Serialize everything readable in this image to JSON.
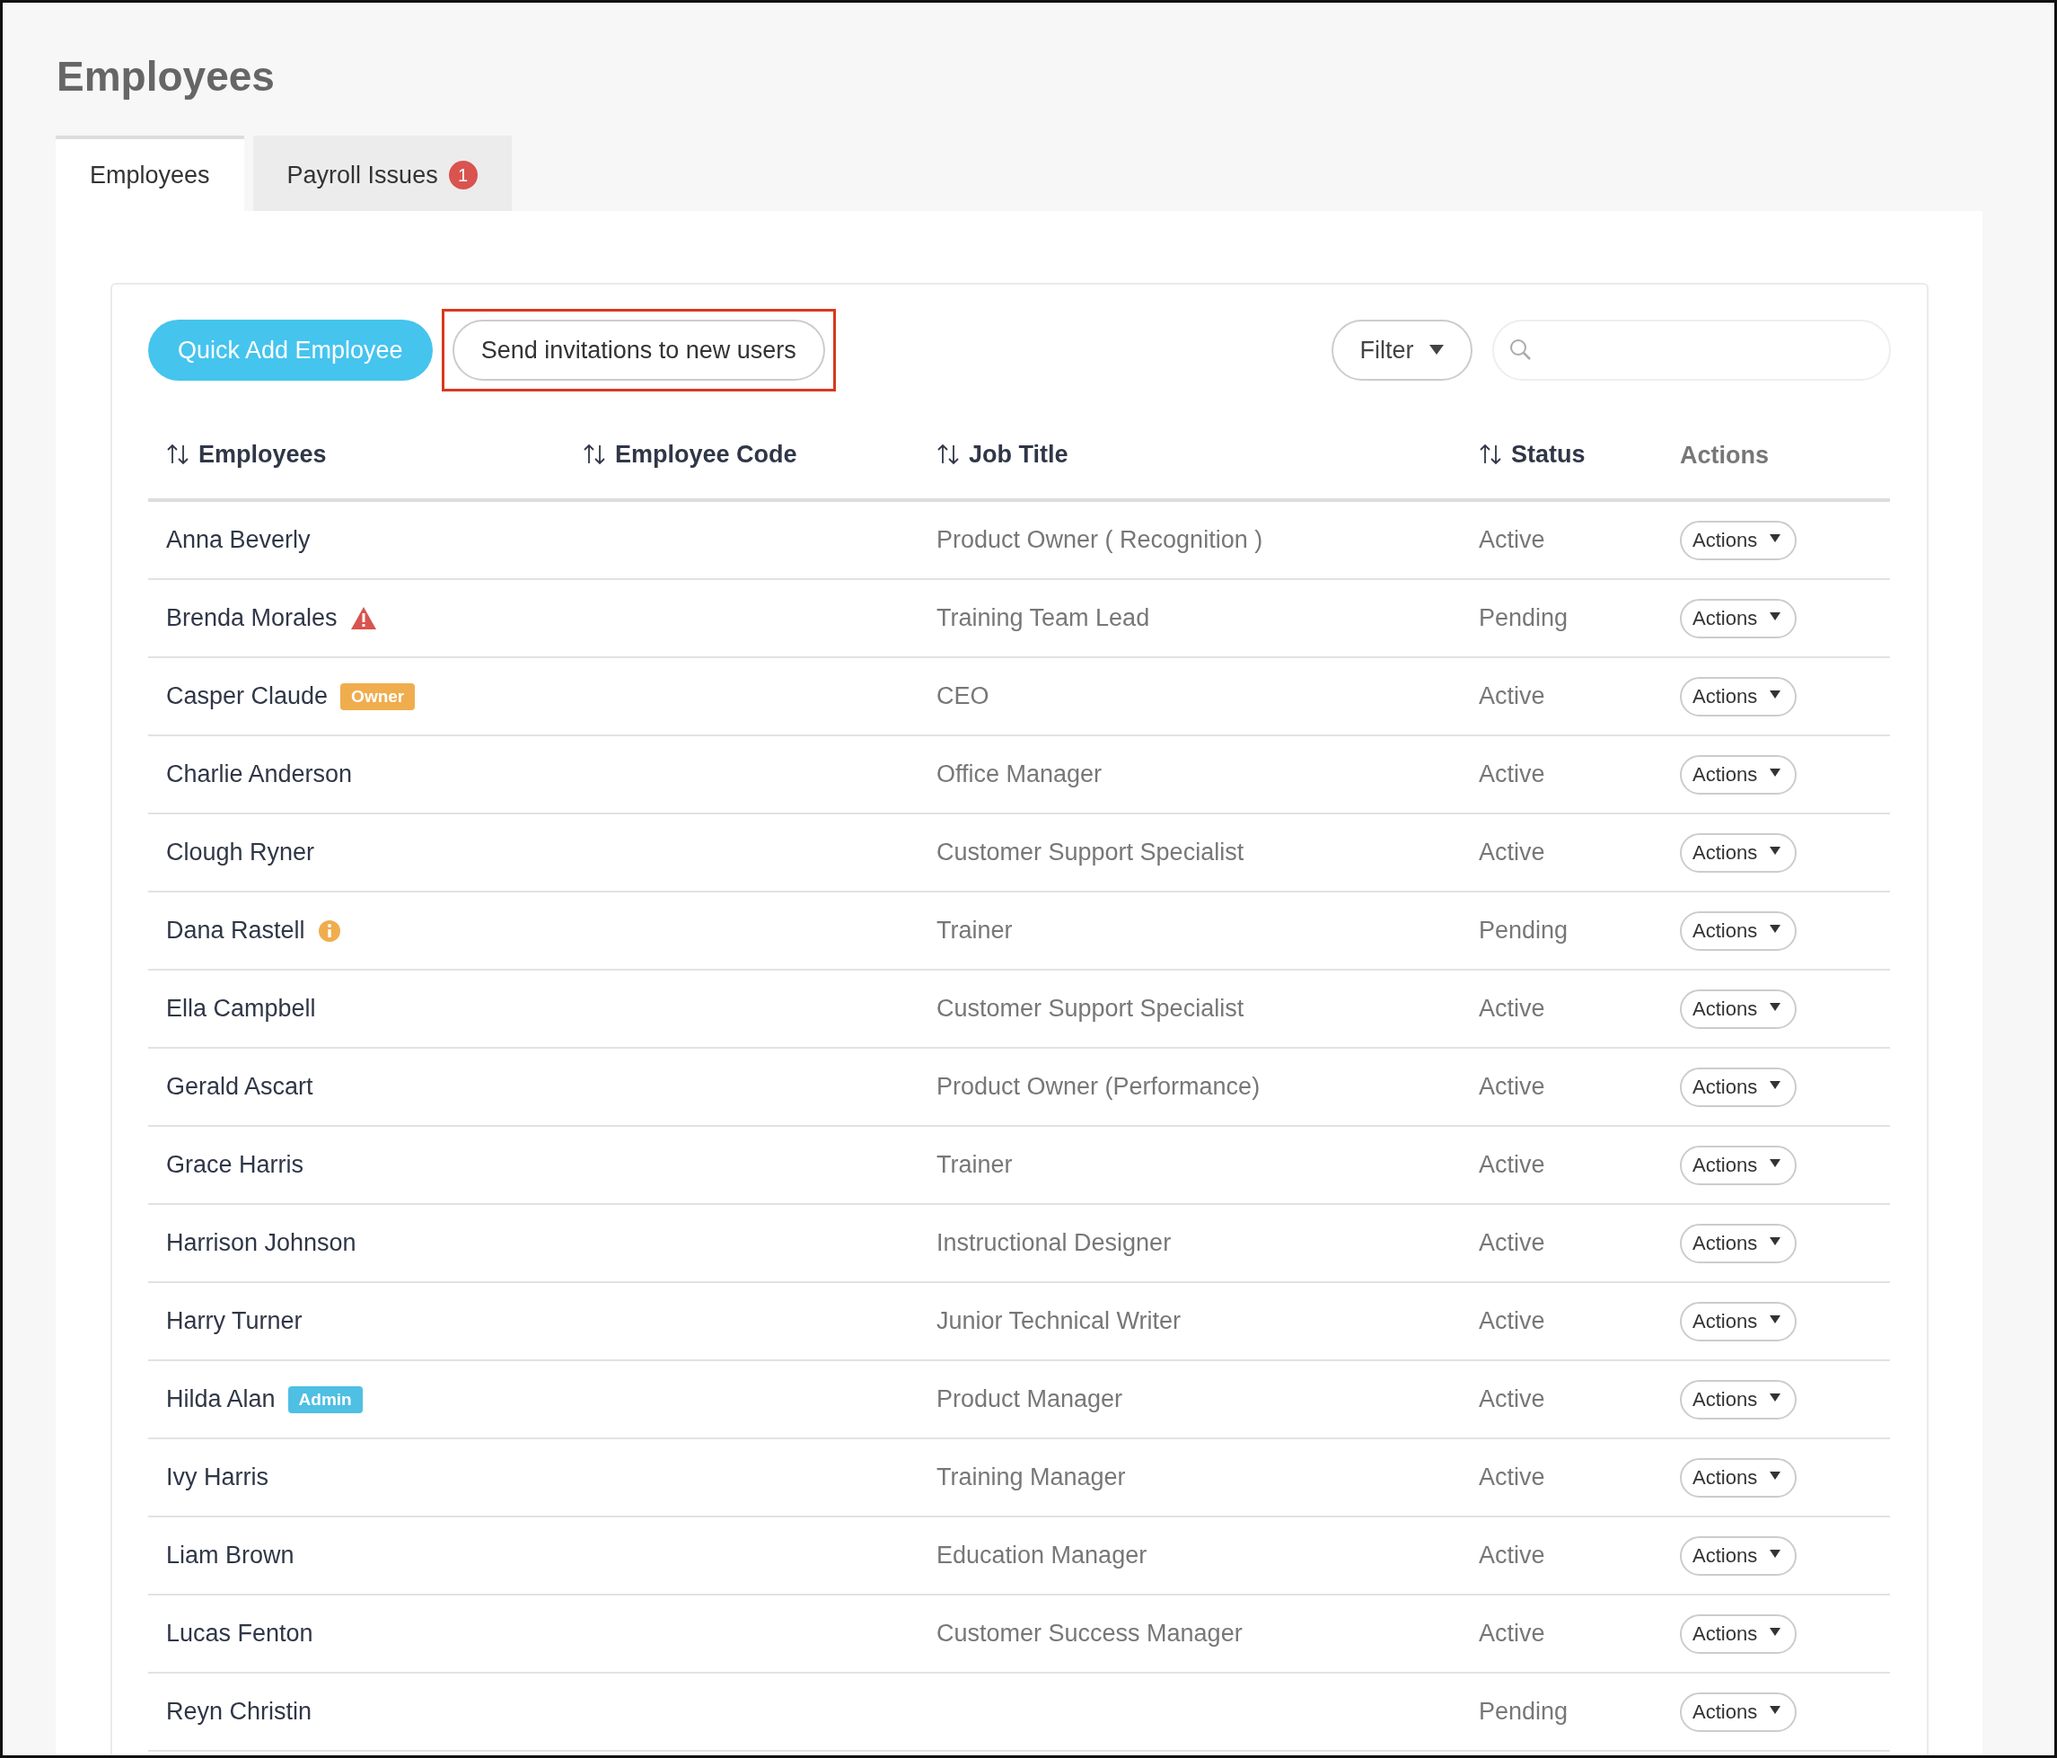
{
  "page_title": "Employees",
  "tabs": [
    {
      "label": "Employees",
      "selected": true
    },
    {
      "label": "Payroll Issues",
      "selected": false,
      "badge": "1"
    }
  ],
  "toolbar": {
    "primary_button": "Quick Add Employee",
    "invite_button": "Send invitations to new users",
    "invite_highlighted": true,
    "filter": "Filter"
  },
  "table": {
    "columns": [
      {
        "label": "Employees",
        "sortable": true
      },
      {
        "label": "Employee Code",
        "sortable": true
      },
      {
        "label": "Job Title",
        "sortable": true
      },
      {
        "label": "Status",
        "sortable": true
      },
      {
        "label": "Actions",
        "sortable": false
      }
    ],
    "rows": [
      {
        "name": "Anna Beverly",
        "job_title": "Product Owner ( Recognition )",
        "status": "Active",
        "actions": "Actions"
      },
      {
        "name": "Brenda Morales",
        "alert": {
          "kind": "warning"
        },
        "job_title": "Training Team Lead",
        "status": "Pending",
        "actions": "Actions"
      },
      {
        "name": "Casper Claude",
        "tag": {
          "kind": "owner",
          "label": "Owner"
        },
        "job_title": "CEO",
        "status": "Active",
        "actions": "Actions"
      },
      {
        "name": "Charlie Anderson",
        "job_title": "Office Manager",
        "status": "Active",
        "actions": "Actions"
      },
      {
        "name": "Clough Ryner",
        "job_title": "Customer Support Specialist",
        "status": "Active",
        "actions": "Actions"
      },
      {
        "name": "Dana Rastell",
        "alert": {
          "kind": "info"
        },
        "job_title": "Trainer",
        "status": "Pending",
        "actions": "Actions"
      },
      {
        "name": "Ella Campbell",
        "job_title": "Customer Support Specialist",
        "status": "Active",
        "actions": "Actions"
      },
      {
        "name": "Gerald Ascart",
        "job_title": "Product Owner (Performance)",
        "status": "Active",
        "actions": "Actions"
      },
      {
        "name": "Grace Harris",
        "job_title": "Trainer",
        "status": "Active",
        "actions": "Actions"
      },
      {
        "name": "Harrison Johnson",
        "job_title": "Instructional Designer",
        "status": "Active",
        "actions": "Actions"
      },
      {
        "name": "Harry Turner",
        "job_title": "Junior Technical Writer",
        "status": "Active",
        "actions": "Actions"
      },
      {
        "name": "Hilda Alan",
        "tag": {
          "kind": "admin",
          "label": "Admin"
        },
        "job_title": "Product Manager",
        "status": "Active",
        "actions": "Actions"
      },
      {
        "name": "Ivy Harris",
        "job_title": "Training Manager",
        "status": "Active",
        "actions": "Actions"
      },
      {
        "name": "Liam Brown",
        "job_title": "Education Manager",
        "status": "Active",
        "actions": "Actions"
      },
      {
        "name": "Lucas Fenton",
        "job_title": "Customer Success Manager",
        "status": "Active",
        "actions": "Actions"
      },
      {
        "name": "Reyn Christin",
        "status": "Pending",
        "actions": "Actions"
      }
    ]
  }
}
